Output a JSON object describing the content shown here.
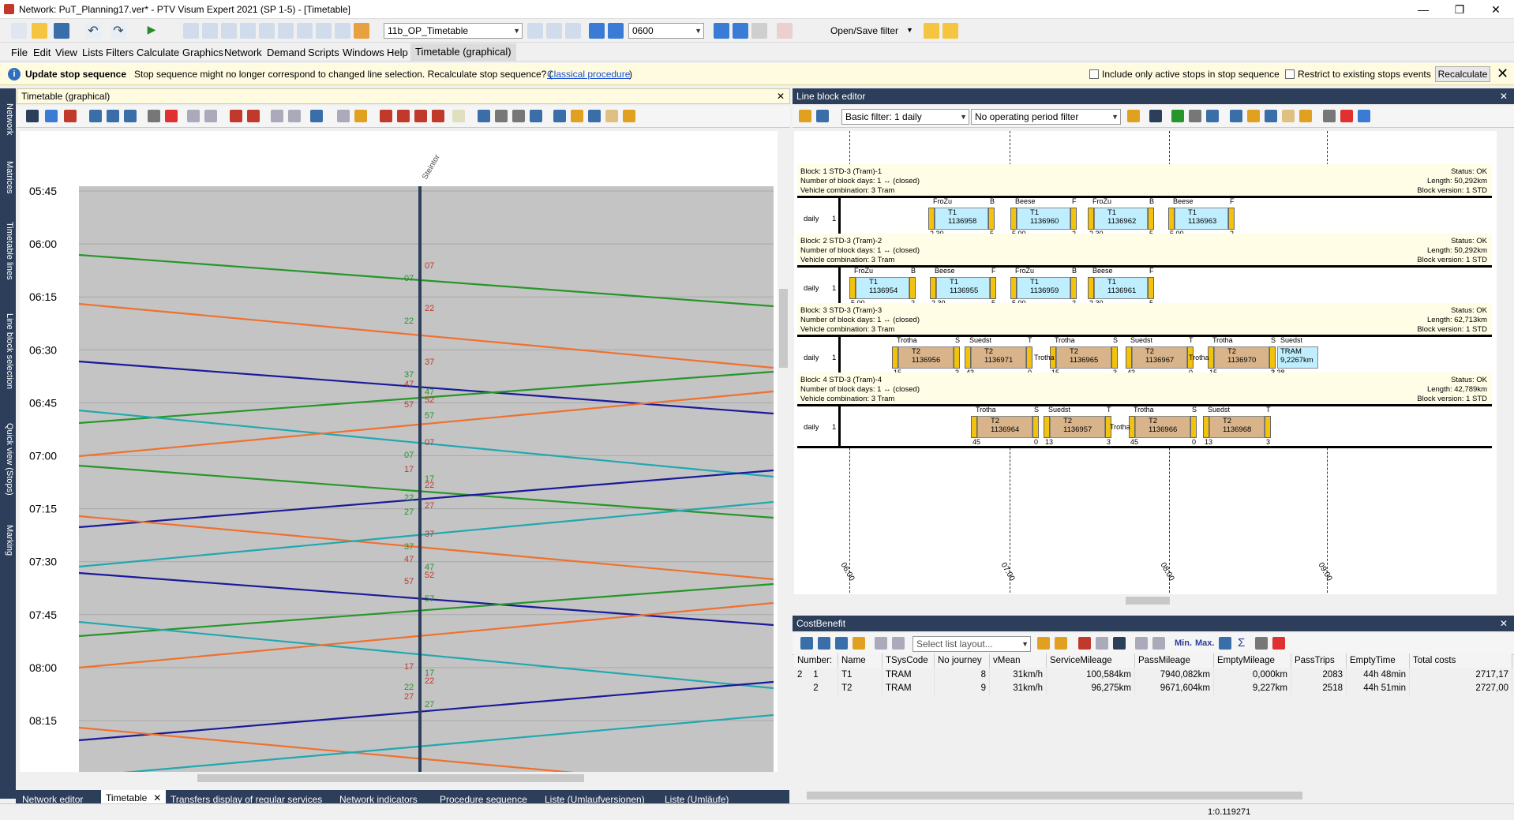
{
  "window": {
    "title": "Network: PuT_Planning17.ver* - PTV Visum Expert 2021 (SP 1-5) - [Timetable]"
  },
  "toolbar": {
    "layout_combo": "11b_OP_Timetable",
    "time_field": "0600",
    "filter_label": "Open/Save filter"
  },
  "menu": [
    "File",
    "Edit",
    "View",
    "Lists",
    "Filters",
    "Calculate",
    "Graphics",
    "Network",
    "Demand",
    "Scripts",
    "Windows",
    "Help",
    "Timetable (graphical)"
  ],
  "infobar": {
    "title": "Update stop sequence",
    "message": "Stop sequence might no longer correspond to changed line selection. Recalculate stop sequence? (",
    "link": "Classical procedure",
    "message_end": ")",
    "check1": "Include only active stops in stop sequence",
    "check2": "Restrict to existing stops events",
    "recalc": "Recalculate"
  },
  "sidebar_tabs": [
    "Network",
    "Matrices",
    "Timetable lines",
    "Line block selection",
    "Quick view (Stops)",
    "Marking"
  ],
  "timetable": {
    "header": "Timetable (graphical)",
    "stop": "Steintor",
    "times": [
      "05:45",
      "06:00",
      "06:15",
      "06:30",
      "06:45",
      "07:00",
      "07:15",
      "07:30",
      "07:45",
      "08:00",
      "08:15"
    ],
    "labels": [
      {
        "t": "07",
        "c": "#c0392b"
      },
      {
        "t": "07",
        "c": "#27962a"
      },
      {
        "t": "22",
        "c": "#c0392b"
      },
      {
        "t": "22",
        "c": "#27962a"
      },
      {
        "t": "37",
        "c": "#c0392b"
      },
      {
        "t": "37",
        "c": "#27962a"
      },
      {
        "t": "47",
        "c": "#c0392b"
      },
      {
        "t": "47",
        "c": "#27962a"
      },
      {
        "t": "52",
        "c": "#c0392b"
      },
      {
        "t": "57",
        "c": "#c0392b"
      },
      {
        "t": "57",
        "c": "#27962a"
      },
      {
        "t": "07",
        "c": "#c0392b"
      },
      {
        "t": "07",
        "c": "#27962a"
      },
      {
        "t": "17",
        "c": "#c0392b"
      },
      {
        "t": "17",
        "c": "#27962a"
      },
      {
        "t": "22",
        "c": "#c0392b"
      },
      {
        "t": "22",
        "c": "#27962a"
      },
      {
        "t": "27",
        "c": "#c0392b"
      },
      {
        "t": "27",
        "c": "#27962a"
      },
      {
        "t": "37",
        "c": "#c0392b"
      },
      {
        "t": "37",
        "c": "#27962a"
      },
      {
        "t": "47",
        "c": "#c0392b"
      },
      {
        "t": "47",
        "c": "#27962a"
      },
      {
        "t": "52",
        "c": "#c0392b"
      },
      {
        "t": "57",
        "c": "#c0392b"
      },
      {
        "t": "57",
        "c": "#27962a"
      },
      {
        "t": "17",
        "c": "#c0392b"
      },
      {
        "t": "17",
        "c": "#27962a"
      },
      {
        "t": "22",
        "c": "#c0392b"
      },
      {
        "t": "22",
        "c": "#27962a"
      },
      {
        "t": "27",
        "c": "#c0392b"
      },
      {
        "t": "27",
        "c": "#27962a"
      }
    ]
  },
  "lineblock": {
    "header": "Line block editor",
    "filter1": "Basic filter: 1 daily",
    "filter2": "No operating period filter",
    "axis": [
      "06:00",
      "07:00",
      "08:00",
      "09:00"
    ],
    "blocks": [
      {
        "l1": "Block: 1 STD-3 (Tram)-1",
        "l2": "Number of block days: 1 ↔ (closed)",
        "l3": "Vehicle combination: 3 Tram",
        "r1": "Status: OK",
        "r2": "Length: 50,292km",
        "r3": "Block version: 1 STD",
        "day": "daily",
        "n": "1",
        "cells": [
          {
            "top": "FroZu",
            "a": "T1",
            "b": "1136958",
            "bl": "2 30",
            "end": "B",
            "br": "5"
          },
          {
            "top": "Beese",
            "a": "T1",
            "b": "1136960",
            "bl": "5 00",
            "end": "F",
            "br": "2"
          },
          {
            "top": "FroZu",
            "a": "T1",
            "b": "1136962",
            "bl": "2 30",
            "end": "B",
            "br": "5"
          },
          {
            "top": "Beese",
            "a": "T1",
            "b": "1136963",
            "bl": "5 00",
            "end": "F",
            "br": "2"
          }
        ]
      },
      {
        "l1": "Block: 2 STD-3 (Tram)-2",
        "l2": "Number of block days: 1 ↔ (closed)",
        "l3": "Vehicle combination: 3 Tram",
        "r1": "Status: OK",
        "r2": "Length: 50,292km",
        "r3": "Block version: 1 STD",
        "day": "daily",
        "n": "1",
        "cells": [
          {
            "top": "FroZu",
            "a": "T1",
            "b": "1136954",
            "bl": "5 00",
            "end": "B",
            "br": "2"
          },
          {
            "top": "Beese",
            "a": "T1",
            "b": "1136955",
            "bl": "2 30",
            "end": "F",
            "br": "5"
          },
          {
            "top": "FroZu",
            "a": "T1",
            "b": "1136959",
            "bl": "5 00",
            "end": "B",
            "br": "2"
          },
          {
            "top": "Beese",
            "a": "T1",
            "b": "1136961",
            "bl": "2 30",
            "end": "F",
            "br": "5"
          }
        ]
      },
      {
        "l1": "Block: 3 STD-3 (Tram)-3",
        "l2": "Number of block days: 1 ↔ (closed)",
        "l3": "Vehicle combination: 3 Tram",
        "r1": "Status: OK",
        "r2": "Length: 62,713km",
        "r3": "Block version: 1 STD",
        "day": "daily",
        "n": "1",
        "cells": [
          {
            "top": "Trotha",
            "a": "T2",
            "b": "1136956",
            "bl": "15",
            "end": "S",
            "br": "3"
          },
          {
            "top": "Suedst",
            "a": "T2",
            "b": "1136971",
            "bl": "43",
            "end": "T",
            "br": "0"
          },
          {
            "top": "Trotha",
            "a": "T2",
            "b": "1136965",
            "bl": "15",
            "end": "S",
            "br": "3"
          },
          {
            "top": "Suedst",
            "a": "T2",
            "b": "1136967",
            "bl": "43",
            "end": "T",
            "br": "0"
          },
          {
            "top": "Trotha",
            "a": "T2",
            "b": "1136970",
            "bl": "15",
            "end": "S",
            "br": "3"
          }
        ],
        "mid": "Trotha",
        "extra": {
          "top": "Suedst",
          "a": "TRAM",
          "b": "9,2267km",
          "bl": "3 38"
        }
      },
      {
        "l1": "Block: 4 STD-3 (Tram)-4",
        "l2": "Number of block days: 1 ↔ (closed)",
        "l3": "Vehicle combination: 3 Tram",
        "r1": "Status: OK",
        "r2": "Length: 42,789km",
        "r3": "Block version: 1 STD",
        "day": "daily",
        "n": "1",
        "cells": [
          {
            "top": "Trotha",
            "a": "T2",
            "b": "1136964",
            "bl": "45",
            "end": "S",
            "br": "0"
          },
          {
            "top": "Suedst",
            "a": "T2",
            "b": "1136957",
            "bl": "13",
            "end": "T",
            "br": "3"
          },
          {
            "top": "Trotha",
            "a": "T2",
            "b": "1136966",
            "bl": "45",
            "end": "S",
            "br": "0"
          },
          {
            "top": "Suedst",
            "a": "T2",
            "b": "1136968",
            "bl": "13",
            "end": "T",
            "br": "3"
          }
        ],
        "mid": "Trotha"
      }
    ]
  },
  "costbenefit": {
    "header": "CostBenefit",
    "layout_placeholder": "Select list layout...",
    "minlabel": "Min.",
    "maxlabel": "Max.",
    "columns": [
      "Number: 2",
      "Name",
      "TSysCode",
      "No journey",
      "vMean",
      "ServiceMileage",
      "PassMileage",
      "EmptyMileage",
      "PassTrips",
      "EmptyTime",
      "Total costs"
    ],
    "rows": [
      [
        "1",
        "T1",
        "TRAM",
        "8",
        "31km/h",
        "100,584km",
        "7940,082km",
        "0,000km",
        "2083",
        "44h 48min",
        "2717,17"
      ],
      [
        "2",
        "T2",
        "TRAM",
        "9",
        "31km/h",
        "96,275km",
        "9671,604km",
        "9,227km",
        "2518",
        "44h 51min",
        "2727,00"
      ]
    ]
  },
  "bottom_tabs": [
    "Network editor",
    "Timetable",
    "Transfers display of regular services",
    "Network indicators",
    "Procedure sequence",
    "Liste (Umlaufversionen)",
    "Liste (Umläufe)"
  ],
  "status": {
    "scale": "1:0.119271"
  },
  "colors": {
    "dark": "#2c3e5a",
    "green": "#27962a",
    "orange": "#f07030",
    "blue": "#1a1a9a",
    "teal": "#20a8b0",
    "red": "#c0392b"
  }
}
